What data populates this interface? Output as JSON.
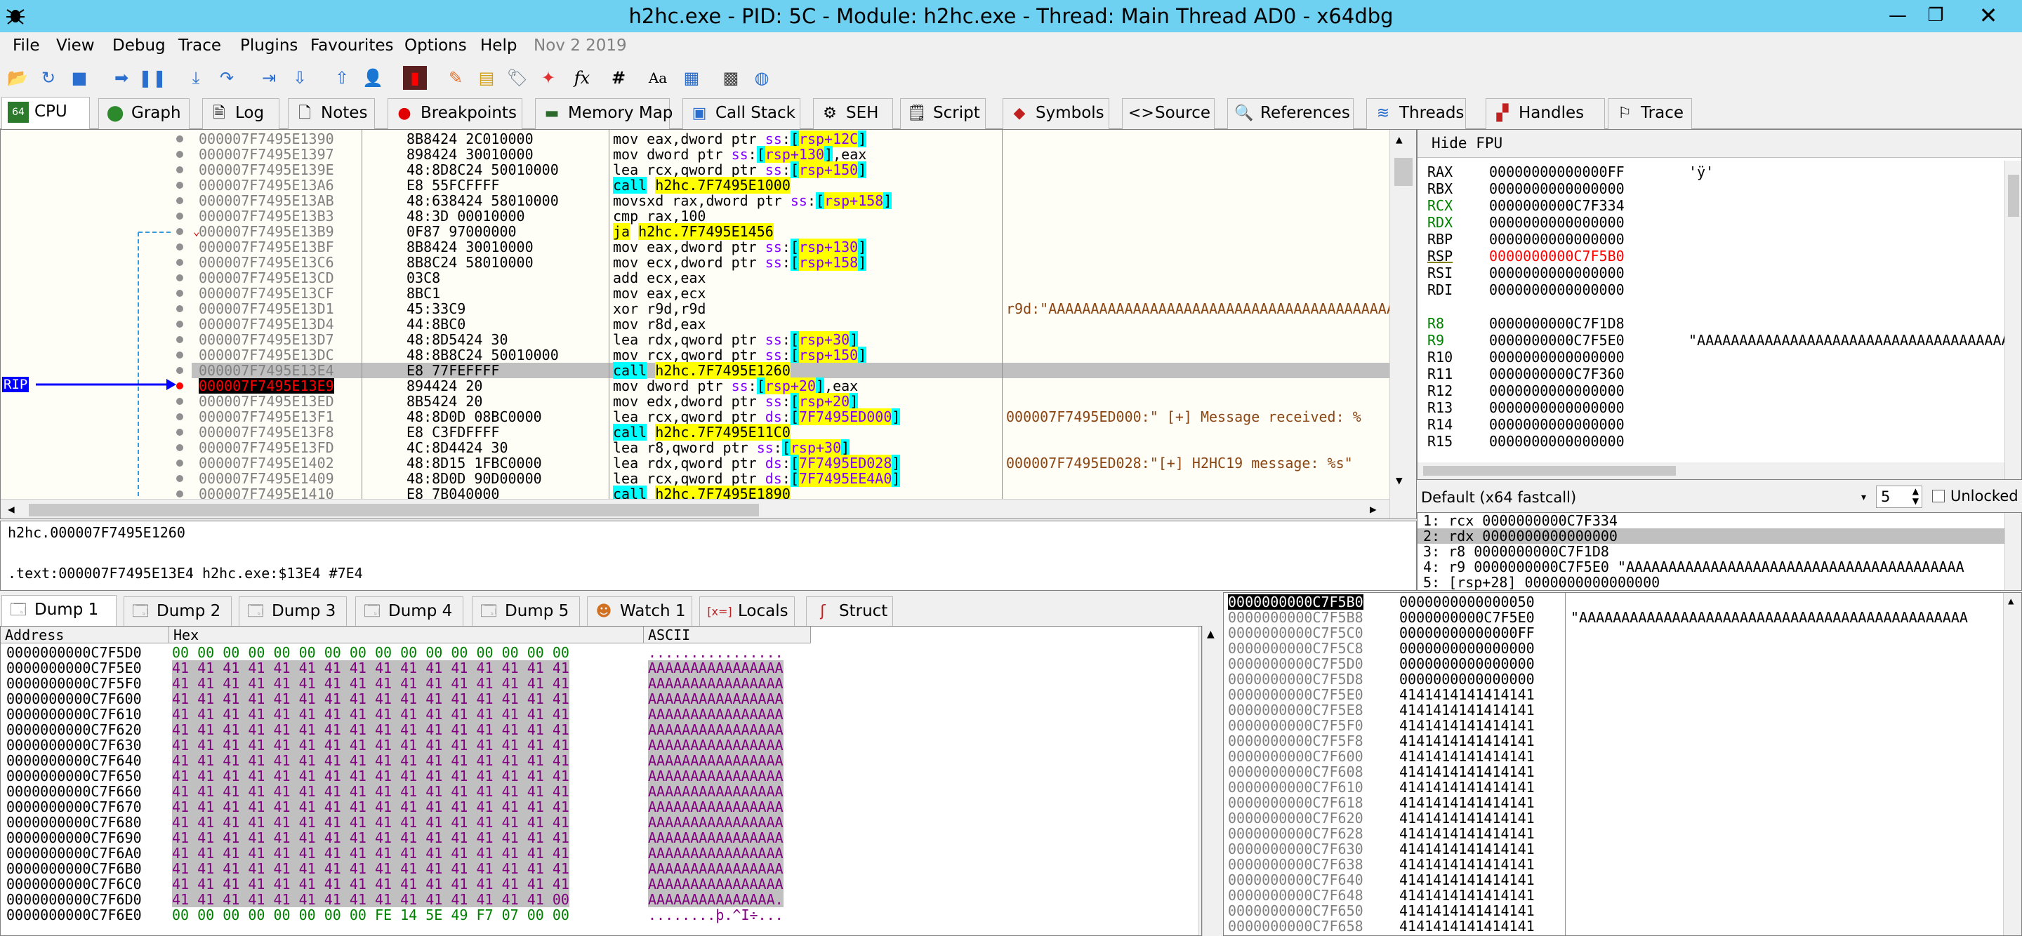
{
  "window": {
    "title": "h2hc.exe - PID: 5C - Module: h2hc.exe - Thread: Main Thread AD0 - x64dbg"
  },
  "menu": {
    "items": [
      "File",
      "View",
      "Debug",
      "Trace",
      "Plugins",
      "Favourites",
      "Options",
      "Help"
    ],
    "date": "Nov 2 2019"
  },
  "toolbar": {
    "icons": [
      "open-icon",
      "restart-icon",
      "close-icon",
      "run-icon",
      "pause-icon",
      "step-into-icon",
      "step-over-icon",
      "trace-into-icon",
      "trace-over-icon",
      "execute-till-return-icon",
      "run-to-user-code-icon",
      "scylla-icon",
      "patch-icon",
      "comment-icon",
      "label-icon",
      "bookmark-icon",
      "function-icon",
      "hash-icon",
      "font-icon",
      "strings-icon",
      "calculator-icon",
      "globe-icon"
    ],
    "fx": "fx",
    "hash": "#",
    "aa": "Aa"
  },
  "tabs": [
    {
      "label": "CPU",
      "icon": "cpu-icon"
    },
    {
      "label": "Graph",
      "icon": "graph-icon"
    },
    {
      "label": "Log",
      "icon": "log-icon"
    },
    {
      "label": "Notes",
      "icon": "notes-icon"
    },
    {
      "label": "Breakpoints",
      "icon": "breakpoint-icon"
    },
    {
      "label": "Memory Map",
      "icon": "memory-icon"
    },
    {
      "label": "Call Stack",
      "icon": "callstack-icon"
    },
    {
      "label": "SEH",
      "icon": "seh-icon"
    },
    {
      "label": "Script",
      "icon": "script-icon"
    },
    {
      "label": "Symbols",
      "icon": "symbols-icon"
    },
    {
      "label": "Source",
      "icon": "source-icon"
    },
    {
      "label": "References",
      "icon": "references-icon"
    },
    {
      "label": "Threads",
      "icon": "threads-icon"
    },
    {
      "label": "Handles",
      "icon": "handles-icon"
    },
    {
      "label": "Trace",
      "icon": "trace-icon"
    }
  ],
  "disasm": {
    "rip_label": "RIP",
    "rows": [
      {
        "addr": "000007F7495E1390",
        "bytes": "8B8424 2C010000",
        "ins": "mov eax,dword ptr ss:[rsp+12C]",
        "cmt": ""
      },
      {
        "addr": "000007F7495E1397",
        "bytes": "898424 30010000",
        "ins": "mov dword ptr ss:[rsp+130],eax",
        "cmt": ""
      },
      {
        "addr": "000007F7495E139E",
        "bytes": "48:8D8C24 50010000",
        "ins": "lea rcx,qword ptr ss:[rsp+150]",
        "cmt": ""
      },
      {
        "addr": "000007F7495E13A6",
        "bytes": "E8 55FCFFFF",
        "ins": "call h2hc.7F7495E1000",
        "cmt": ""
      },
      {
        "addr": "000007F7495E13AB",
        "bytes": "48:638424 58010000",
        "ins": "movsxd rax,dword ptr ss:[rsp+158]",
        "cmt": ""
      },
      {
        "addr": "000007F7495E13B3",
        "bytes": "48:3D 00010000",
        "ins": "cmp rax,100",
        "cmt": ""
      },
      {
        "addr": "000007F7495E13B9",
        "bytes": "0F87 97000000",
        "ins": "ja h2hc.7F7495E1456",
        "cmt": ""
      },
      {
        "addr": "000007F7495E13BF",
        "bytes": "8B8424 30010000",
        "ins": "mov eax,dword ptr ss:[rsp+130]",
        "cmt": ""
      },
      {
        "addr": "000007F7495E13C6",
        "bytes": "8B8C24 58010000",
        "ins": "mov ecx,dword ptr ss:[rsp+158]",
        "cmt": ""
      },
      {
        "addr": "000007F7495E13CD",
        "bytes": "03C8",
        "ins": "add ecx,eax",
        "cmt": ""
      },
      {
        "addr": "000007F7495E13CF",
        "bytes": "8BC1",
        "ins": "mov eax,ecx",
        "cmt": ""
      },
      {
        "addr": "000007F7495E13D1",
        "bytes": "45:33C9",
        "ins": "xor r9d,r9d",
        "cmt": "r9d:\"AAAAAAAAAAAAAAAAAAAAAAAAAAAAAAAAAAAAAAAAAA"
      },
      {
        "addr": "000007F7495E13D4",
        "bytes": "44:8BC0",
        "ins": "mov r8d,eax",
        "cmt": ""
      },
      {
        "addr": "000007F7495E13D7",
        "bytes": "48:8D5424 30",
        "ins": "lea rdx,qword ptr ss:[rsp+30]",
        "cmt": ""
      },
      {
        "addr": "000007F7495E13DC",
        "bytes": "48:8B8C24 50010000",
        "ins": "mov rcx,qword ptr ss:[rsp+150]",
        "cmt": ""
      },
      {
        "addr": "000007F7495E13E4",
        "bytes": "E8 77FEFFFF",
        "ins": "call h2hc.7F7495E1260",
        "cmt": ""
      },
      {
        "addr": "000007F7495E13E9",
        "bytes": "894424 20",
        "ins": "mov dword ptr ss:[rsp+20],eax",
        "cmt": ""
      },
      {
        "addr": "000007F7495E13ED",
        "bytes": "8B5424 20",
        "ins": "mov edx,dword ptr ss:[rsp+20]",
        "cmt": ""
      },
      {
        "addr": "000007F7495E13F1",
        "bytes": "48:8D0D 08BC0000",
        "ins": "lea rcx,qword ptr ds:[7F7495ED000]",
        "cmt": "000007F7495ED000:\" [+] Message received: %"
      },
      {
        "addr": "000007F7495E13F8",
        "bytes": "E8 C3FDFFFF",
        "ins": "call h2hc.7F7495E11C0",
        "cmt": ""
      },
      {
        "addr": "000007F7495E13FD",
        "bytes": "4C:8D4424 30",
        "ins": "lea r8,qword ptr ss:[rsp+30]",
        "cmt": ""
      },
      {
        "addr": "000007F7495E1402",
        "bytes": "48:8D15 1FBC0000",
        "ins": "lea rdx,qword ptr ds:[7F7495ED028]",
        "cmt": "000007F7495ED028:\"[+] H2HC19 message: %s\""
      },
      {
        "addr": "000007F7495E1409",
        "bytes": "48:8D0D 90D00000",
        "ins": "lea rcx,qword ptr ds:[7F7495EE4A0]",
        "cmt": ""
      },
      {
        "addr": "000007F7495E1410",
        "bytes": "E8 7B040000",
        "ins": "call h2hc.7F7495E1890",
        "cmt": ""
      }
    ]
  },
  "registers": {
    "header": "Hide FPU",
    "rows": [
      {
        "name": "RAX",
        "val": "00000000000000FF",
        "note": "'ÿ'",
        "color": "#000000"
      },
      {
        "name": "RBX",
        "val": "0000000000000000",
        "note": "",
        "color": "#000000"
      },
      {
        "name": "RCX",
        "val": "0000000000C7F334",
        "note": "",
        "color": "#008000"
      },
      {
        "name": "RDX",
        "val": "0000000000000000",
        "note": "",
        "color": "#008000"
      },
      {
        "name": "RBP",
        "val": "0000000000000000",
        "note": "",
        "color": "#000000"
      },
      {
        "name": "RSP",
        "val": "0000000000C7F5B0",
        "note": "",
        "color": "#ff0000"
      },
      {
        "name": "RSI",
        "val": "0000000000000000",
        "note": "",
        "color": "#000000"
      },
      {
        "name": "RDI",
        "val": "0000000000000000",
        "note": "",
        "color": "#000000"
      },
      {
        "name": "R8",
        "val": "0000000000C7F1D8",
        "note": "",
        "color": "#008000"
      },
      {
        "name": "R9",
        "val": "0000000000C7F5E0",
        "note": "\"AAAAAAAAAAAAAAAAAAAAAAAAAAAAAAAAAAAAAAAA",
        "color": "#008000"
      },
      {
        "name": "R10",
        "val": "0000000000000000",
        "note": "",
        "color": "#000000"
      },
      {
        "name": "R11",
        "val": "0000000000C7F360",
        "note": "",
        "color": "#000000"
      },
      {
        "name": "R12",
        "val": "0000000000000000",
        "note": "",
        "color": "#000000"
      },
      {
        "name": "R13",
        "val": "0000000000000000",
        "note": "",
        "color": "#000000"
      },
      {
        "name": "R14",
        "val": "0000000000000000",
        "note": "",
        "color": "#000000"
      },
      {
        "name": "R15",
        "val": "0000000000000000",
        "note": "",
        "color": "#000000"
      }
    ]
  },
  "callconv": {
    "label": "Default (x64 fastcall)",
    "count": "5",
    "unlocked": "Unlocked"
  },
  "stackargs": [
    "1: rcx 0000000000C7F334",
    "2: rdx 0000000000000000",
    "3: r8 0000000000C7F1D8",
    "4: r9 0000000000C7F5E0 \"AAAAAAAAAAAAAAAAAAAAAAAAAAAAAAAAAAAAAAAA",
    "5: [rsp+28] 0000000000000000"
  ],
  "info": {
    "line1": "h2hc.000007F7495E1260",
    "line2": ".text:000007F7495E13E4 h2hc.exe:$13E4 #7E4"
  },
  "dumptabs": [
    {
      "label": "Dump 1",
      "icon": "dump-icon"
    },
    {
      "label": "Dump 2",
      "icon": "dump-icon"
    },
    {
      "label": "Dump 3",
      "icon": "dump-icon"
    },
    {
      "label": "Dump 4",
      "icon": "dump-icon"
    },
    {
      "label": "Dump 5",
      "icon": "dump-icon"
    },
    {
      "label": "Watch 1",
      "icon": "watch-icon"
    },
    {
      "label": "Locals",
      "icon": "locals-icon"
    },
    {
      "label": "Struct",
      "icon": "struct-icon"
    }
  ],
  "dump": {
    "headers": [
      "Address",
      "Hex",
      "ASCII"
    ],
    "rows": [
      {
        "addr": "0000000000C7F5D0",
        "hex": "00 00 00 00 00 00 00 00 00 00 00 00 00 00 00 00",
        "ascii": "................"
      },
      {
        "addr": "0000000000C7F5E0",
        "hex": "41 41 41 41 41 41 41 41 41 41 41 41 41 41 41 41",
        "ascii": "AAAAAAAAAAAAAAAA"
      },
      {
        "addr": "0000000000C7F5F0",
        "hex": "41 41 41 41 41 41 41 41 41 41 41 41 41 41 41 41",
        "ascii": "AAAAAAAAAAAAAAAA"
      },
      {
        "addr": "0000000000C7F600",
        "hex": "41 41 41 41 41 41 41 41 41 41 41 41 41 41 41 41",
        "ascii": "AAAAAAAAAAAAAAAA"
      },
      {
        "addr": "0000000000C7F610",
        "hex": "41 41 41 41 41 41 41 41 41 41 41 41 41 41 41 41",
        "ascii": "AAAAAAAAAAAAAAAA"
      },
      {
        "addr": "0000000000C7F620",
        "hex": "41 41 41 41 41 41 41 41 41 41 41 41 41 41 41 41",
        "ascii": "AAAAAAAAAAAAAAAA"
      },
      {
        "addr": "0000000000C7F630",
        "hex": "41 41 41 41 41 41 41 41 41 41 41 41 41 41 41 41",
        "ascii": "AAAAAAAAAAAAAAAA"
      },
      {
        "addr": "0000000000C7F640",
        "hex": "41 41 41 41 41 41 41 41 41 41 41 41 41 41 41 41",
        "ascii": "AAAAAAAAAAAAAAAA"
      },
      {
        "addr": "0000000000C7F650",
        "hex": "41 41 41 41 41 41 41 41 41 41 41 41 41 41 41 41",
        "ascii": "AAAAAAAAAAAAAAAA"
      },
      {
        "addr": "0000000000C7F660",
        "hex": "41 41 41 41 41 41 41 41 41 41 41 41 41 41 41 41",
        "ascii": "AAAAAAAAAAAAAAAA"
      },
      {
        "addr": "0000000000C7F670",
        "hex": "41 41 41 41 41 41 41 41 41 41 41 41 41 41 41 41",
        "ascii": "AAAAAAAAAAAAAAAA"
      },
      {
        "addr": "0000000000C7F680",
        "hex": "41 41 41 41 41 41 41 41 41 41 41 41 41 41 41 41",
        "ascii": "AAAAAAAAAAAAAAAA"
      },
      {
        "addr": "0000000000C7F690",
        "hex": "41 41 41 41 41 41 41 41 41 41 41 41 41 41 41 41",
        "ascii": "AAAAAAAAAAAAAAAA"
      },
      {
        "addr": "0000000000C7F6A0",
        "hex": "41 41 41 41 41 41 41 41 41 41 41 41 41 41 41 41",
        "ascii": "AAAAAAAAAAAAAAAA"
      },
      {
        "addr": "0000000000C7F6B0",
        "hex": "41 41 41 41 41 41 41 41 41 41 41 41 41 41 41 41",
        "ascii": "AAAAAAAAAAAAAAAA"
      },
      {
        "addr": "0000000000C7F6C0",
        "hex": "41 41 41 41 41 41 41 41 41 41 41 41 41 41 41 41",
        "ascii": "AAAAAAAAAAAAAAAA"
      },
      {
        "addr": "0000000000C7F6D0",
        "hex": "41 41 41 41 41 41 41 41 41 41 41 41 41 41 41 00",
        "ascii": "AAAAAAAAAAAAAAA."
      },
      {
        "addr": "0000000000C7F6E0",
        "hex": "00 00 00 00 00 00 00 00 FE 14 5E 49 F7 07 00 00",
        "ascii": "........þ.^I÷..."
      }
    ]
  },
  "stack": {
    "rows": [
      {
        "addr": "0000000000C7F5B0",
        "val": "0000000000000050",
        "cmt": ""
      },
      {
        "addr": "0000000000C7F5B8",
        "val": "0000000000C7F5E0",
        "cmt": "\"AAAAAAAAAAAAAAAAAAAAAAAAAAAAAAAAAAAAAAAAAAAAAA"
      },
      {
        "addr": "0000000000C7F5C0",
        "val": "00000000000000FF",
        "cmt": ""
      },
      {
        "addr": "0000000000C7F5C8",
        "val": "0000000000000000",
        "cmt": ""
      },
      {
        "addr": "0000000000C7F5D0",
        "val": "0000000000000000",
        "cmt": ""
      },
      {
        "addr": "0000000000C7F5D8",
        "val": "0000000000000000",
        "cmt": ""
      },
      {
        "addr": "0000000000C7F5E0",
        "val": "4141414141414141",
        "cmt": ""
      },
      {
        "addr": "0000000000C7F5E8",
        "val": "4141414141414141",
        "cmt": ""
      },
      {
        "addr": "0000000000C7F5F0",
        "val": "4141414141414141",
        "cmt": ""
      },
      {
        "addr": "0000000000C7F5F8",
        "val": "4141414141414141",
        "cmt": ""
      },
      {
        "addr": "0000000000C7F600",
        "val": "4141414141414141",
        "cmt": ""
      },
      {
        "addr": "0000000000C7F608",
        "val": "4141414141414141",
        "cmt": ""
      },
      {
        "addr": "0000000000C7F610",
        "val": "4141414141414141",
        "cmt": ""
      },
      {
        "addr": "0000000000C7F618",
        "val": "4141414141414141",
        "cmt": ""
      },
      {
        "addr": "0000000000C7F620",
        "val": "4141414141414141",
        "cmt": ""
      },
      {
        "addr": "0000000000C7F628",
        "val": "4141414141414141",
        "cmt": ""
      },
      {
        "addr": "0000000000C7F630",
        "val": "4141414141414141",
        "cmt": ""
      },
      {
        "addr": "0000000000C7F638",
        "val": "4141414141414141",
        "cmt": ""
      },
      {
        "addr": "0000000000C7F640",
        "val": "4141414141414141",
        "cmt": ""
      },
      {
        "addr": "0000000000C7F648",
        "val": "4141414141414141",
        "cmt": ""
      },
      {
        "addr": "0000000000C7F650",
        "val": "4141414141414141",
        "cmt": ""
      },
      {
        "addr": "0000000000C7F658",
        "val": "4141414141414141",
        "cmt": ""
      }
    ]
  },
  "colors": {
    "titlebar": "#6fd1f2",
    "call_highlight": "#00ffff",
    "jump_highlight": "#ffff00",
    "rip_arrow": "#0000ff",
    "breakpoint": "#ff0000",
    "dump_selected": "#c0c0c0",
    "hex_text": "#800080",
    "zero_text": "#008000"
  }
}
